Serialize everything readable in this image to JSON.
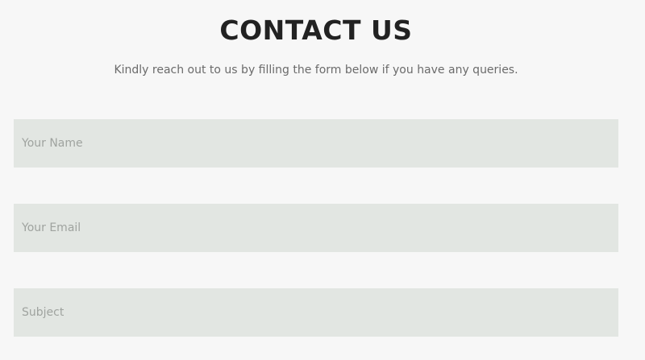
{
  "header": {
    "title": "CONTACT US",
    "subtitle": "Kindly reach out to us by filling the form below if you have any queries."
  },
  "form": {
    "name": {
      "placeholder": "Your Name",
      "value": ""
    },
    "email": {
      "placeholder": "Your Email",
      "value": ""
    },
    "subject": {
      "placeholder": "Subject",
      "value": ""
    }
  }
}
